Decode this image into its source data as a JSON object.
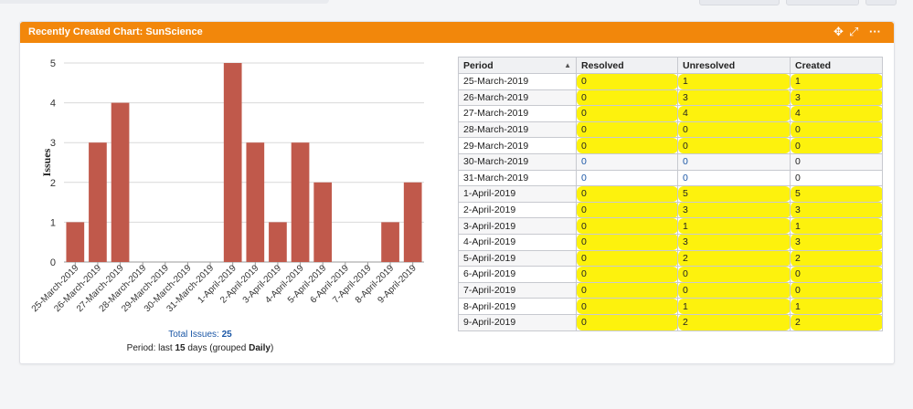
{
  "gadget": {
    "title": "Recently Created Chart: SunScience",
    "header_color": "#f2870b"
  },
  "summary": {
    "total_label": "Total Issues:",
    "total_value": "25",
    "period_prefix": "Period: last",
    "period_days": "15",
    "period_middle": "days (grouped",
    "period_group": "Daily",
    "period_suffix": ")"
  },
  "chart_data": {
    "type": "bar",
    "ylabel": "Issues",
    "ylim": [
      0,
      5
    ],
    "yticks": [
      "0",
      "1",
      "2",
      "3",
      "4",
      "5"
    ],
    "categories": [
      "25-March-2019",
      "26-March-2019",
      "27-March-2019",
      "28-March-2019",
      "29-March-2019",
      "30-March-2019",
      "31-March-2019",
      "1-April-2019",
      "2-April-2019",
      "3-April-2019",
      "4-April-2019",
      "5-April-2019",
      "6-April-2019",
      "7-April-2019",
      "8-April-2019",
      "9-April-2019"
    ],
    "values": [
      1,
      3,
      4,
      0,
      0,
      0,
      0,
      5,
      3,
      1,
      3,
      2,
      0,
      0,
      1,
      2
    ],
    "bar_color": "#c0594b",
    "grid": true
  },
  "table": {
    "headers": [
      "Period",
      "Resolved",
      "Unresolved",
      "Created"
    ],
    "rows": [
      {
        "period": "25-March-2019",
        "resolved": "0",
        "unresolved": "1",
        "created": "1",
        "highlighted": true
      },
      {
        "period": "26-March-2019",
        "resolved": "0",
        "unresolved": "3",
        "created": "3",
        "highlighted": true
      },
      {
        "period": "27-March-2019",
        "resolved": "0",
        "unresolved": "4",
        "created": "4",
        "highlighted": true
      },
      {
        "period": "28-March-2019",
        "resolved": "0",
        "unresolved": "0",
        "created": "0",
        "highlighted": true
      },
      {
        "period": "29-March-2019",
        "resolved": "0",
        "unresolved": "0",
        "created": "0",
        "highlighted": true
      },
      {
        "period": "30-March-2019",
        "resolved": "0",
        "unresolved": "0",
        "created": "0",
        "highlighted": false
      },
      {
        "period": "31-March-2019",
        "resolved": "0",
        "unresolved": "0",
        "created": "0",
        "highlighted": false
      },
      {
        "period": "1-April-2019",
        "resolved": "0",
        "unresolved": "5",
        "created": "5",
        "highlighted": true
      },
      {
        "period": "2-April-2019",
        "resolved": "0",
        "unresolved": "3",
        "created": "3",
        "highlighted": true
      },
      {
        "period": "3-April-2019",
        "resolved": "0",
        "unresolved": "1",
        "created": "1",
        "highlighted": true
      },
      {
        "period": "4-April-2019",
        "resolved": "0",
        "unresolved": "3",
        "created": "3",
        "highlighted": true
      },
      {
        "period": "5-April-2019",
        "resolved": "0",
        "unresolved": "2",
        "created": "2",
        "highlighted": true
      },
      {
        "period": "6-April-2019",
        "resolved": "0",
        "unresolved": "0",
        "created": "0",
        "highlighted": true
      },
      {
        "period": "7-April-2019",
        "resolved": "0",
        "unresolved": "0",
        "created": "0",
        "highlighted": true
      },
      {
        "period": "8-April-2019",
        "resolved": "0",
        "unresolved": "1",
        "created": "1",
        "highlighted": true
      },
      {
        "period": "9-April-2019",
        "resolved": "0",
        "unresolved": "2",
        "created": "2",
        "highlighted": true
      }
    ],
    "highlight_color": "#fdf20d"
  },
  "icons": [
    "move-icon",
    "collapse-icon",
    "more-icon"
  ]
}
